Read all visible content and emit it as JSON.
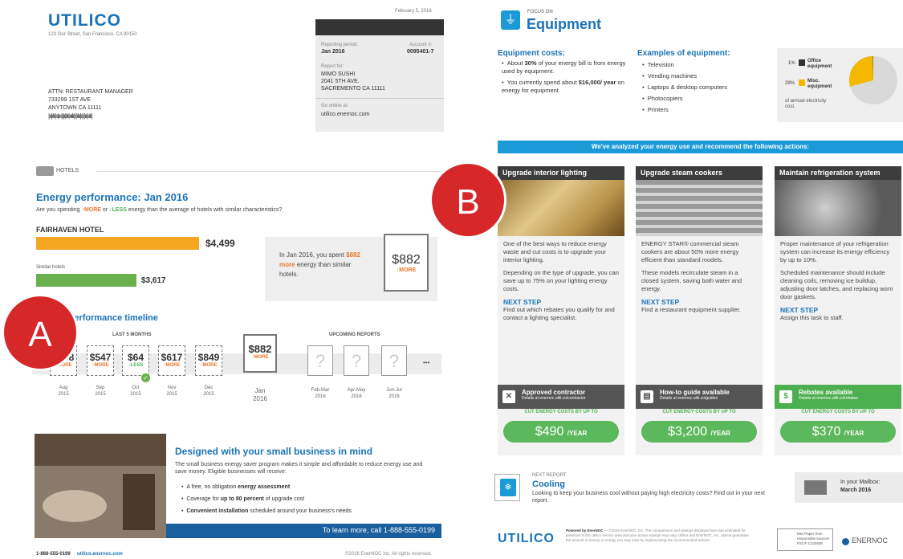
{
  "left": {
    "logo": "UTILICO",
    "address": "123 Our Street, San Francisco, CA 90150",
    "date": "February 5, 2016",
    "attn": [
      "ATTN: RESTAURANT MANAGER",
      "733299 1ST AVE",
      "ANYTOWN CA  11111"
    ],
    "barcode": "|ıı|ılı|ıı|ııı|ı|ı|ılı|ııılı|ı|ılıı|ı|ı|ıı|ıılı|",
    "box": {
      "period_label": "Reporting period:",
      "period": "Jan 2016",
      "acct_label": "Account #:",
      "acct": "0095401-7",
      "for_label": "Report for:",
      "for": [
        "MIMO SUSHI",
        "2041 5TH AVE.",
        "SACREMENTO CA  11111"
      ],
      "online_label": "Go online at:",
      "online": "utilico.enernoc.com"
    },
    "section": "HOTELS",
    "perf_title": "Energy performance: Jan 2016",
    "perf_q": [
      "Are you spending ",
      "↑MORE",
      " or ",
      "↓LESS",
      " energy than the average of hotels with similar characteristics?"
    ],
    "hotel": "FAIRHAVEN HOTEL",
    "hotel_val": "$4,499",
    "similar": "Similar hotels",
    "similar_val": "$3,617",
    "summary": [
      "In Jan 2016, you spent ",
      "$882 more",
      " energy than similar hotels."
    ],
    "doc_val": "$882",
    "doc_sub": "↑MORE",
    "timeline_title": "Performance timeline",
    "last5": "LAST 5 MONTHS",
    "upcoming": "UPCOMING REPORTS",
    "tl": [
      {
        "v": "$798",
        "s": "↑MORE",
        "d": [
          "Aug",
          "2015"
        ]
      },
      {
        "v": "$547",
        "s": "↑MORE",
        "d": [
          "Sep",
          "2015"
        ]
      },
      {
        "v": "$64",
        "s": "↓LESS",
        "d": [
          "Oct",
          "2015"
        ]
      },
      {
        "v": "$617",
        "s": "↑MORE",
        "d": [
          "Nov",
          "2015"
        ]
      },
      {
        "v": "$849",
        "s": "↑MORE",
        "d": [
          "Dec",
          "2015"
        ]
      }
    ],
    "cur": {
      "v": "$882",
      "s": "↑MORE",
      "d": [
        "Jan",
        "2016"
      ]
    },
    "up": [
      [
        "Feb-Mar",
        "2016"
      ],
      [
        "Apr-May",
        "2016"
      ],
      [
        "Jun-Jul",
        "2016"
      ]
    ],
    "more": "•••",
    "promo_title": "Designed with your small business in mind",
    "promo_text": "The small business energy saver program makes it simple and affordable to reduce energy use and save money. Eligible businesses will receive:",
    "promo_bullets": [
      [
        "A free, no obligation ",
        "energy assessment",
        ""
      ],
      [
        "Coverage for ",
        "up to 80 percent",
        " of upgrade cost"
      ],
      [
        "",
        "Convenient installation",
        " scheduled around your business's needs"
      ]
    ],
    "promo_call": "To learn more, call 1-888-555-0199",
    "foot_phone": "1-888-555-0199",
    "foot_url": "utilico.enernoc.com",
    "foot_copy": "©2016 EnerNOC Inc. All rights reserved."
  },
  "right": {
    "focus": "FOCUS ON",
    "title": "Equipment",
    "costs_title": "Equipment costs:",
    "costs": [
      [
        "About ",
        "30%",
        " of your energy bill is from energy used by equipment."
      ],
      [
        "You currently spend about ",
        "$16,000/ year",
        " on energy for equipment."
      ]
    ],
    "examples_title": "Examples of equipment:",
    "examples": [
      "Television",
      "Vending machines",
      "Laptops & desktop computers",
      "Photocopiers",
      "Printers"
    ],
    "pie": {
      "l1": "1%",
      "n1": "Office equipment",
      "l2": "29%",
      "n2": "Misc. equipment",
      "note": "of annual electricity cost."
    },
    "banner": "We've analyzed your energy use and recommend the following actions:",
    "actions": [
      {
        "title": "Upgrade interior lighting",
        "p1": "One of the best ways to reduce energy waste and cut costs is to upgrade your interior lighting.",
        "p2": "Depending on the type of upgrade, you can save up to 75% on your lighting energy costs.",
        "ns": "NEXT STEP",
        "ns_text": "Find out which rebates you qualify for and contact a lighting specialist.",
        "foot": "Approved contractor",
        "foot_d": "Details at enernoc.utili.co/contractor",
        "cut": "CUT ENERGY COSTS BY UP TO",
        "val": "$490",
        "per": "/YEAR"
      },
      {
        "title": "Upgrade steam cookers",
        "p1": "ENERGY STAR® commercial steam cookers are about 50% more energy efficient than standard models.",
        "p2": "These models recirculate steam in a closed system, saving both water and energy.",
        "ns": "NEXT STEP",
        "ns_text": "Find a restaurant equipment supplier.",
        "foot": "How-to guide available",
        "foot_d": "Details at enernoc.utili.co/guides",
        "cut": "CUT ENERGY COSTS BY UP TO",
        "val": "$3,200",
        "per": "/YEAR"
      },
      {
        "title": "Maintain refrigeration system",
        "p1": "Proper maintenance of your refrigeration system can increase its energy efficiency by up to 10%.",
        "p2": "Scheduled maintenance should include cleaning coils, removing ice buildup, adjusting door latches, and replacing worn door gaskets.",
        "ns": "NEXT STEP",
        "ns_text": "Assign this task to staff.",
        "foot": "Rebates available",
        "foot_d": "Details at enernoc.utili.co/rebates",
        "cut": "CUT ENERGY COSTS BY UP TO",
        "val": "$370",
        "per": "/YEAR"
      }
    ],
    "next_label": "NEXT REPORT",
    "next_title": "Cooling",
    "next_text": "Looking to keep your business cool without paying high electricity costs? Find out in your next report.",
    "mail_label": "In your Mailbox:",
    "mail_date": "March 2016",
    "logo": "UTILICO",
    "powered": "Powered by EnerNOC",
    "fine": "— ©2016 EnerNOC, Inc. The comparisons and savings displayed here are estimated for premises in the Utilico service area and your actual savings may vary. Utilico and EnerNOC, Inc. cannot guarantee the amount of money or energy you may save by implementing the recommended actions.",
    "fsc": "MIX Paper from responsible sources FSC® C102835",
    "enernoc": "ENERNOC"
  },
  "bubbles": {
    "a": "A",
    "b": "B"
  },
  "colors": {
    "blue": "#1a73b8",
    "orange": "#f5a623",
    "green": "#6ab04c",
    "red": "#d62729",
    "dark": "#3d3d3d"
  }
}
